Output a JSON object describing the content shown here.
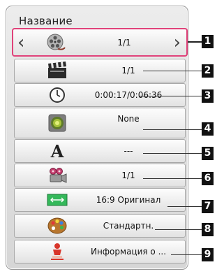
{
  "panel": {
    "title": "Название"
  },
  "rows": [
    {
      "value": "1/1",
      "icon": "film-reel-icon"
    },
    {
      "value": "1/1",
      "icon": "clapperboard-icon"
    },
    {
      "value": "0:00:17/0:06:36",
      "icon": "clock-icon"
    },
    {
      "value": "None",
      "icon": "speaker-icon"
    },
    {
      "value": "---",
      "icon": "subtitle-a-icon"
    },
    {
      "value": "1/1",
      "icon": "camera-angle-icon"
    },
    {
      "value": "16:9 Оригинал",
      "icon": "aspect-ratio-icon"
    },
    {
      "value": "Стандартн.",
      "icon": "palette-icon"
    },
    {
      "value": "Информация о ...",
      "icon": "info-icon"
    }
  ],
  "callouts": [
    "1",
    "2",
    "3",
    "4",
    "5",
    "6",
    "7",
    "8",
    "9"
  ],
  "colors": {
    "selection_border": "#e0427a",
    "callout_bg": "#111111"
  }
}
